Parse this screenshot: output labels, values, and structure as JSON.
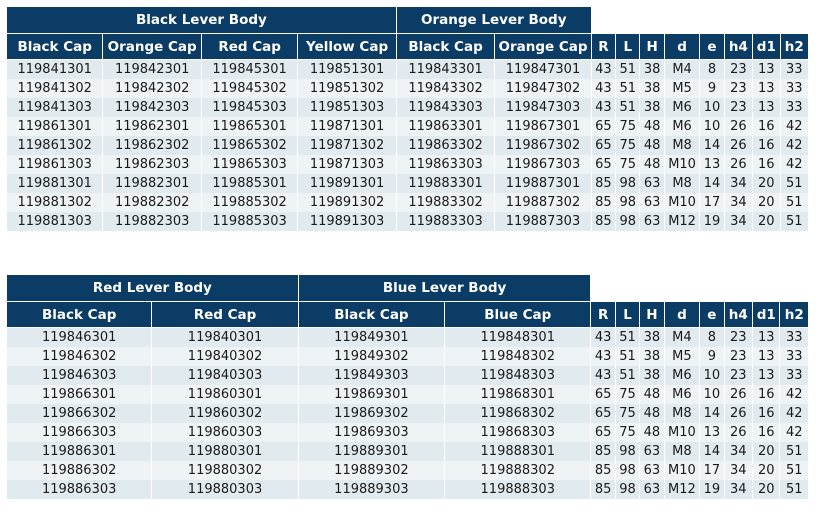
{
  "table1": {
    "groups": [
      "Black Lever Body",
      "Orange Lever Body"
    ],
    "headers": [
      "Black Cap",
      "Orange Cap",
      "Red Cap",
      "Yellow Cap",
      "Black Cap",
      "Orange Cap",
      "R",
      "L",
      "H",
      "d",
      "e",
      "h4",
      "d1",
      "h2"
    ],
    "rows": [
      [
        "119841301",
        "119842301",
        "119845301",
        "119851301",
        "119843301",
        "119847301",
        "43",
        "51",
        "38",
        "M4",
        "8",
        "23",
        "13",
        "33"
      ],
      [
        "119841302",
        "119842302",
        "119845302",
        "119851302",
        "119843302",
        "119847302",
        "43",
        "51",
        "38",
        "M5",
        "9",
        "23",
        "13",
        "33"
      ],
      [
        "119841303",
        "119842303",
        "119845303",
        "119851303",
        "119843303",
        "119847303",
        "43",
        "51",
        "38",
        "M6",
        "10",
        "23",
        "13",
        "33"
      ],
      [
        "119861301",
        "119862301",
        "119865301",
        "119871301",
        "119863301",
        "119867301",
        "65",
        "75",
        "48",
        "M6",
        "10",
        "26",
        "16",
        "42"
      ],
      [
        "119861302",
        "119862302",
        "119865302",
        "119871302",
        "119863302",
        "119867302",
        "65",
        "75",
        "48",
        "M8",
        "14",
        "26",
        "16",
        "42"
      ],
      [
        "119861303",
        "119862303",
        "119865303",
        "119871303",
        "119863303",
        "119867303",
        "65",
        "75",
        "48",
        "M10",
        "13",
        "26",
        "16",
        "42"
      ],
      [
        "119881301",
        "119882301",
        "119885301",
        "119891301",
        "119883301",
        "119887301",
        "85",
        "98",
        "63",
        "M8",
        "14",
        "34",
        "20",
        "51"
      ],
      [
        "119881302",
        "119882302",
        "119885302",
        "119891302",
        "119883302",
        "119887302",
        "85",
        "98",
        "63",
        "M10",
        "17",
        "34",
        "20",
        "51"
      ],
      [
        "119881303",
        "119882303",
        "119885303",
        "119891303",
        "119883303",
        "119887303",
        "85",
        "98",
        "63",
        "M12",
        "19",
        "34",
        "20",
        "51"
      ]
    ]
  },
  "table2": {
    "groups": [
      "Red Lever Body",
      "Blue Lever Body"
    ],
    "headers": [
      "Black Cap",
      "Red Cap",
      "Black Cap",
      "Blue Cap",
      "R",
      "L",
      "H",
      "d",
      "e",
      "h4",
      "d1",
      "h2"
    ],
    "rows": [
      [
        "119846301",
        "119840301",
        "119849301",
        "119848301",
        "43",
        "51",
        "38",
        "M4",
        "8",
        "23",
        "13",
        "33"
      ],
      [
        "119846302",
        "119840302",
        "119849302",
        "119848302",
        "43",
        "51",
        "38",
        "M5",
        "9",
        "23",
        "13",
        "33"
      ],
      [
        "119846303",
        "119840303",
        "119849303",
        "119848303",
        "43",
        "51",
        "38",
        "M6",
        "10",
        "23",
        "13",
        "33"
      ],
      [
        "119866301",
        "119860301",
        "119869301",
        "119868301",
        "65",
        "75",
        "48",
        "M6",
        "10",
        "26",
        "16",
        "42"
      ],
      [
        "119866302",
        "119860302",
        "119869302",
        "119868302",
        "65",
        "75",
        "48",
        "M8",
        "14",
        "26",
        "16",
        "42"
      ],
      [
        "119866303",
        "119860303",
        "119869303",
        "119868303",
        "65",
        "75",
        "48",
        "M10",
        "13",
        "26",
        "16",
        "42"
      ],
      [
        "119886301",
        "119880301",
        "119889301",
        "119888301",
        "85",
        "98",
        "63",
        "M8",
        "14",
        "34",
        "20",
        "51"
      ],
      [
        "119886302",
        "119880302",
        "119889302",
        "119888302",
        "85",
        "98",
        "63",
        "M10",
        "17",
        "34",
        "20",
        "51"
      ],
      [
        "119886303",
        "119880303",
        "119889303",
        "119888303",
        "85",
        "98",
        "63",
        "M12",
        "19",
        "34",
        "20",
        "51"
      ]
    ]
  },
  "colors": {
    "header_bg": "#0b3c66",
    "row_bg": "#e1ebef",
    "row_alt_bg": "#eef3f5"
  }
}
